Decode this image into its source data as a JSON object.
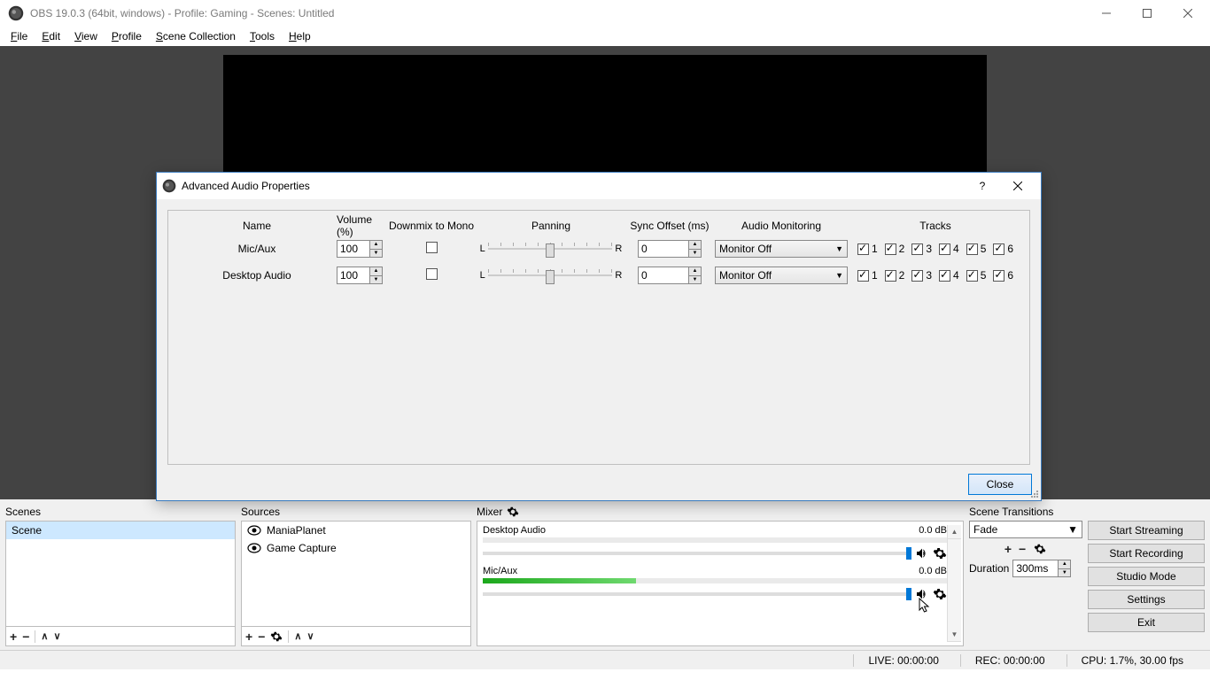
{
  "window": {
    "title": "OBS 19.0.3 (64bit, windows) - Profile: Gaming - Scenes: Untitled"
  },
  "menu": {
    "file": "File",
    "edit": "Edit",
    "view": "View",
    "profile": "Profile",
    "scene_collection": "Scene Collection",
    "tools": "Tools",
    "help": "Help"
  },
  "dialog": {
    "title": "Advanced Audio Properties",
    "close_label": "Close",
    "headers": {
      "name": "Name",
      "volume": "Volume (%)",
      "mono": "Downmix to Mono",
      "panning": "Panning",
      "sync": "Sync Offset (ms)",
      "monitor": "Audio Monitoring",
      "tracks": "Tracks"
    },
    "pan_l": "L",
    "pan_r": "R",
    "track_labels": {
      "t1": "1",
      "t2": "2",
      "t3": "3",
      "t4": "4",
      "t5": "5",
      "t6": "6"
    },
    "rows": [
      {
        "name": "Mic/Aux",
        "volume": "100",
        "mono": false,
        "sync": "0",
        "monitor": "Monitor Off",
        "tracks": [
          true,
          true,
          true,
          true,
          true,
          true
        ]
      },
      {
        "name": "Desktop Audio",
        "volume": "100",
        "mono": false,
        "sync": "0",
        "monitor": "Monitor Off",
        "tracks": [
          true,
          true,
          true,
          true,
          true,
          true
        ]
      }
    ]
  },
  "panels": {
    "scenes_title": "Scenes",
    "sources_title": "Sources",
    "mixer_title": "Mixer",
    "transitions_title": "Scene Transitions",
    "scenes": [
      "Scene"
    ],
    "sources": [
      "ManiaPlanet",
      "Game Capture"
    ],
    "mixer": [
      {
        "name": "Desktop Audio",
        "db": "0.0 dB",
        "level": 0
      },
      {
        "name": "Mic/Aux",
        "db": "0.0 dB",
        "level": 33
      }
    ],
    "transition_selected": "Fade",
    "duration_label": "Duration",
    "duration_value": "300ms"
  },
  "controls": {
    "start_streaming": "Start Streaming",
    "start_recording": "Start Recording",
    "studio_mode": "Studio Mode",
    "settings": "Settings",
    "exit": "Exit"
  },
  "status": {
    "live": "LIVE: 00:00:00",
    "rec": "REC: 00:00:00",
    "cpu": "CPU: 1.7%, 30.00 fps"
  }
}
